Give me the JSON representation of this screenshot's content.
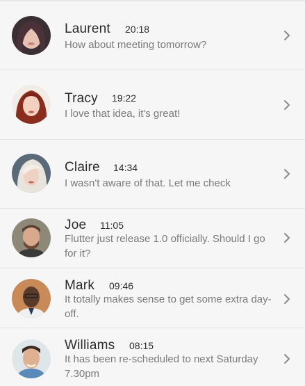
{
  "conversations": [
    {
      "name": "Laurent",
      "time": "20:18",
      "message": "How about meeting tomorrow?",
      "avatar": "laurent-avatar"
    },
    {
      "name": "Tracy",
      "time": "19:22",
      "message": "I love that idea, it's great!",
      "avatar": "tracy-avatar"
    },
    {
      "name": "Claire",
      "time": "14:34",
      "message": "I wasn't aware of that. Let me check",
      "avatar": "claire-avatar"
    },
    {
      "name": "Joe",
      "time": "11:05",
      "message": "Flutter just release 1.0 officially. Should I go for it?",
      "avatar": "joe-avatar"
    },
    {
      "name": "Mark",
      "time": "09:46",
      "message": "It totally makes sense to get some extra day-off.",
      "avatar": "mark-avatar"
    },
    {
      "name": "Williams",
      "time": "08:15",
      "message": "It has been re-scheduled to next Saturday 7.30pm",
      "avatar": "williams-avatar"
    }
  ],
  "icons": {
    "chevron": "chevron-right-icon"
  }
}
